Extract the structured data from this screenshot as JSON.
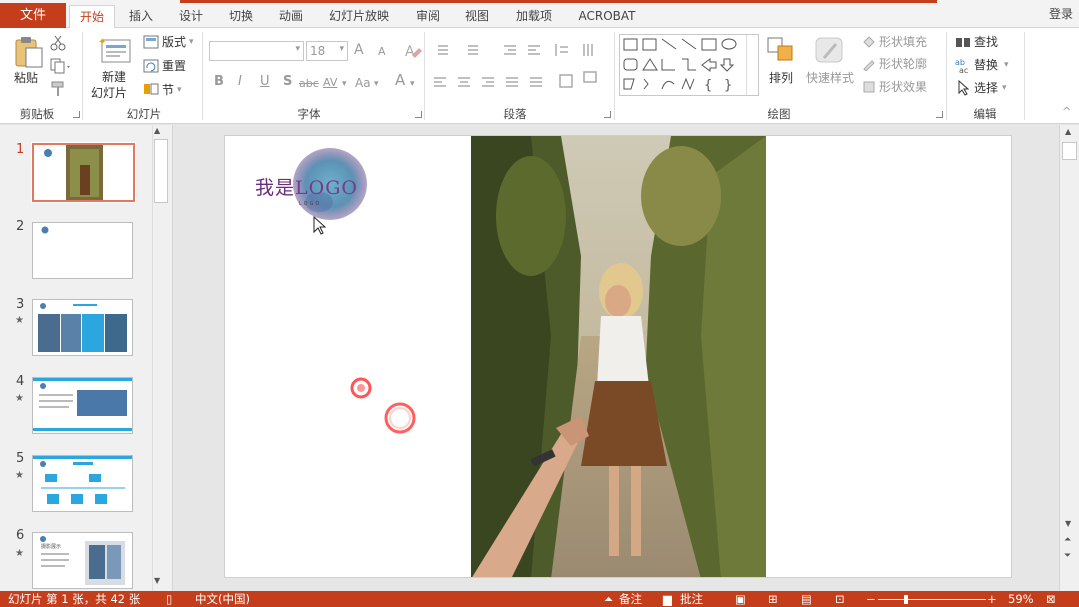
{
  "tabs": {
    "file": "文件",
    "items": [
      "开始",
      "插入",
      "设计",
      "切换",
      "动画",
      "幻灯片放映",
      "审阅",
      "视图",
      "加载项",
      "ACROBAT"
    ],
    "active": "开始",
    "login": "登录"
  },
  "ribbon": {
    "clipboard": {
      "paste": "粘贴",
      "label": "剪贴板"
    },
    "slides": {
      "new_slide_line1": "新建",
      "new_slide_line2": "幻灯片",
      "layout": "版式",
      "reset": "重置",
      "section": "节",
      "label": "幻灯片"
    },
    "font": {
      "font_size": "18",
      "label": "字体",
      "bold": "B",
      "italic": "I",
      "underline": "U",
      "shadow": "S",
      "strike": "abc",
      "spacing": "AV",
      "case": "Aa",
      "color": "A",
      "grow": "A",
      "shrink": "A"
    },
    "paragraph": {
      "label": "段落"
    },
    "drawing": {
      "arrange": "排列",
      "quick_styles": "快速样式",
      "shape_fill": "形状填充",
      "shape_outline": "形状轮廓",
      "shape_effects": "形状效果",
      "label": "绘图"
    },
    "editing": {
      "find": "查找",
      "replace": "替换",
      "select": "选择",
      "label": "编辑"
    }
  },
  "thumbnails": [
    {
      "num": "1",
      "star": false,
      "active": true
    },
    {
      "num": "2",
      "star": false,
      "active": false
    },
    {
      "num": "3",
      "star": true,
      "active": false
    },
    {
      "num": "4",
      "star": true,
      "active": false
    },
    {
      "num": "5",
      "star": true,
      "active": false
    },
    {
      "num": "6",
      "star": true,
      "active": false
    }
  ],
  "thumb_texts": {
    "t6_title": "摄影展示"
  },
  "slide": {
    "logo_text_cn": "我是",
    "logo_text_en": "LOGO",
    "logo_sub": "LOGO"
  },
  "status": {
    "slide_info": "幻灯片 第 1 张，共 42 张",
    "language": "中文(中国)",
    "notes": "备注",
    "comments": "批注",
    "zoom": "59%"
  },
  "colors": {
    "accent": "#c43e1c",
    "logo_purple": "#6a2d7a",
    "logo_blue": "#4a8fb3"
  }
}
